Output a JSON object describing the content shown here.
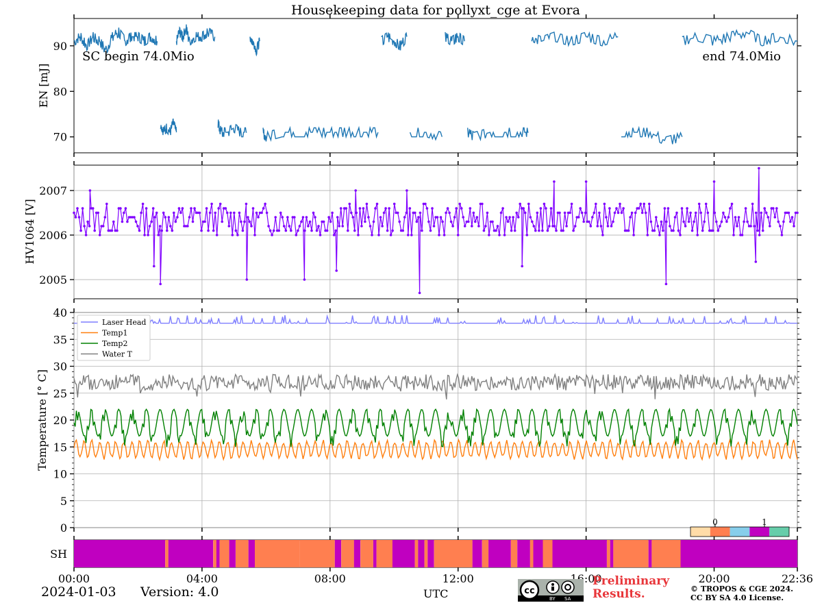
{
  "chart_data": [
    {
      "panel": "energy",
      "type": "line",
      "title": "Housekeeping data for pollyxt_cge at Evora",
      "ylabel": "EN [mJ]",
      "ylim": [
        66.5,
        96.0
      ],
      "yticks": [
        70,
        80,
        90
      ],
      "xlim": [
        0,
        22.6
      ],
      "annotations": {
        "left": "SC begin 74.0Mio",
        "right": "end 74.0Mio"
      },
      "color": "#1f77b4",
      "segments": [
        {
          "x": [
            0.0,
            0.2,
            0.4,
            0.6,
            0.8,
            1.0,
            1.2,
            1.4,
            1.6,
            1.8,
            2.0,
            2.2,
            2.4,
            2.6
          ],
          "y": [
            91,
            92,
            90,
            92,
            91,
            89,
            92,
            93,
            91,
            92,
            92,
            91,
            92,
            91
          ]
        },
        {
          "x": [
            2.7,
            2.8,
            2.9,
            3.0,
            3.1,
            3.2
          ],
          "y": [
            73,
            71,
            72,
            71,
            73,
            71
          ]
        },
        {
          "x": [
            3.2,
            3.3,
            3.4,
            3.5,
            3.6,
            3.8,
            4.0,
            4.2,
            4.4
          ],
          "y": [
            91,
            93,
            92,
            94,
            91,
            92,
            92,
            93,
            92
          ]
        },
        {
          "x": [
            4.5,
            4.6,
            4.8,
            5.0,
            5.2,
            5.4
          ],
          "y": [
            73,
            71,
            71,
            72,
            71,
            71
          ]
        },
        {
          "x": [
            5.5,
            5.6,
            5.7,
            5.8
          ],
          "y": [
            92,
            91,
            89,
            91
          ]
        },
        {
          "x": [
            5.9,
            6.0,
            6.5,
            7.0,
            7.5,
            8.0,
            8.5,
            9.0,
            9.5
          ],
          "y": [
            71,
            70,
            71,
            71,
            71,
            71,
            71,
            71,
            71
          ]
        },
        {
          "x": [
            9.6,
            9.8,
            10.0,
            10.2,
            10.4
          ],
          "y": [
            91,
            92,
            91,
            90,
            92
          ]
        },
        {
          "x": [
            10.5,
            11.0,
            11.5
          ],
          "y": [
            71,
            71,
            70
          ]
        },
        {
          "x": [
            11.6,
            11.8,
            12.0,
            12.2
          ],
          "y": [
            92,
            91,
            92,
            91
          ]
        },
        {
          "x": [
            12.3,
            12.5,
            13.0,
            13.5,
            14.0,
            14.2
          ],
          "y": [
            71,
            70,
            71,
            71,
            71,
            71
          ]
        },
        {
          "x": [
            14.3,
            14.6,
            15.0,
            15.5,
            16.0,
            16.5,
            17.0
          ],
          "y": [
            92,
            91,
            92,
            91,
            92,
            91,
            92
          ]
        },
        {
          "x": [
            17.1,
            17.5,
            18.0,
            18.5,
            19.0
          ],
          "y": [
            71,
            71,
            71,
            69,
            70
          ]
        },
        {
          "x": [
            19.0,
            19.5,
            20.0,
            20.5,
            21.0,
            21.5,
            22.0,
            22.6
          ],
          "y": [
            91,
            92,
            91,
            92,
            93,
            91,
            92,
            91
          ]
        }
      ]
    },
    {
      "panel": "hv1064",
      "type": "line",
      "ylabel": "HV1064 [V]",
      "ylim": [
        2004.57,
        2007.57
      ],
      "yticks": [
        2005,
        2006,
        2007
      ],
      "xlim": [
        0,
        22.6
      ],
      "color": "#8000ff",
      "base": 2006.3,
      "noise_range": [
        2006.0,
        2006.7
      ],
      "outliers": [
        {
          "x": 2.7,
          "y": 2004.9
        },
        {
          "x": 2.5,
          "y": 2005.3
        },
        {
          "x": 5.4,
          "y": 2005.0
        },
        {
          "x": 7.2,
          "y": 2005.0
        },
        {
          "x": 8.2,
          "y": 2005.2
        },
        {
          "x": 10.8,
          "y": 2004.7
        },
        {
          "x": 14.0,
          "y": 2005.3
        },
        {
          "x": 18.5,
          "y": 2004.9
        },
        {
          "x": 21.3,
          "y": 2005.4
        },
        {
          "x": 21.4,
          "y": 2007.5
        },
        {
          "x": 15.0,
          "y": 2007.2
        },
        {
          "x": 16.0,
          "y": 2007.2
        },
        {
          "x": 20.0,
          "y": 2007.2
        },
        {
          "x": 0.5,
          "y": 2007.0
        },
        {
          "x": 8.8,
          "y": 2007.0
        },
        {
          "x": 10.4,
          "y": 2007.0
        }
      ]
    },
    {
      "panel": "temperature",
      "type": "line",
      "ylabel": "Temperature [$^\\circ C$]",
      "ylim": [
        0,
        40
      ],
      "yticks": [
        0,
        5,
        10,
        15,
        20,
        25,
        30,
        35,
        40
      ],
      "xlim": [
        0,
        22.6
      ],
      "legend": "top-left",
      "series": [
        {
          "name": "Laser Head",
          "color": "#7f7fff",
          "base": 38,
          "amp": 1.0
        },
        {
          "name": "Temp1",
          "color": "#ff7f0e",
          "base": 14.5,
          "amp": 1.5
        },
        {
          "name": "Temp2",
          "color": "#008000",
          "base": 19.5,
          "amp": 2.5
        },
        {
          "name": "Water T",
          "color": "#808080",
          "base": 27,
          "amp": 1.5
        }
      ]
    },
    {
      "panel": "shutter",
      "type": "heatmap",
      "ylabel": "SH",
      "colorbar_ticks": [
        "0",
        "1"
      ],
      "colorbar_colors": [
        "#ffdca8",
        "#ff7f50",
        "#87ceeb",
        "#c000c0",
        "#66cdaa"
      ],
      "states": {
        "0": "#ff7f50",
        "1": "#c000c0"
      },
      "timeline": [
        {
          "start": 0.0,
          "end": 2.85,
          "state": "1"
        },
        {
          "start": 2.85,
          "end": 2.95,
          "state": "0"
        },
        {
          "start": 2.95,
          "end": 4.35,
          "state": "1"
        },
        {
          "start": 4.35,
          "end": 4.45,
          "state": "0"
        },
        {
          "start": 4.45,
          "end": 4.55,
          "state": "1"
        },
        {
          "start": 4.55,
          "end": 4.85,
          "state": "0"
        },
        {
          "start": 4.85,
          "end": 5.05,
          "state": "1"
        },
        {
          "start": 5.05,
          "end": 5.45,
          "state": "0"
        },
        {
          "start": 5.45,
          "end": 5.65,
          "state": "1"
        },
        {
          "start": 5.65,
          "end": 7.05,
          "state": "0"
        },
        {
          "start": 7.05,
          "end": 8.15,
          "state": "0"
        },
        {
          "start": 8.15,
          "end": 8.35,
          "state": "1"
        },
        {
          "start": 8.35,
          "end": 8.75,
          "state": "0"
        },
        {
          "start": 8.75,
          "end": 8.95,
          "state": "1"
        },
        {
          "start": 8.95,
          "end": 9.35,
          "state": "0"
        },
        {
          "start": 9.35,
          "end": 9.45,
          "state": "1"
        },
        {
          "start": 9.45,
          "end": 9.95,
          "state": "0"
        },
        {
          "start": 9.95,
          "end": 10.65,
          "state": "1"
        },
        {
          "start": 10.65,
          "end": 10.75,
          "state": "0"
        },
        {
          "start": 10.75,
          "end": 10.95,
          "state": "1"
        },
        {
          "start": 10.95,
          "end": 11.05,
          "state": "0"
        },
        {
          "start": 11.05,
          "end": 11.25,
          "state": "1"
        },
        {
          "start": 11.25,
          "end": 12.45,
          "state": "0"
        },
        {
          "start": 12.45,
          "end": 12.75,
          "state": "1"
        },
        {
          "start": 12.75,
          "end": 12.95,
          "state": "0"
        },
        {
          "start": 12.95,
          "end": 13.65,
          "state": "1"
        },
        {
          "start": 13.65,
          "end": 13.85,
          "state": "0"
        },
        {
          "start": 13.85,
          "end": 14.25,
          "state": "1"
        },
        {
          "start": 14.25,
          "end": 14.35,
          "state": "0"
        },
        {
          "start": 14.35,
          "end": 14.65,
          "state": "1"
        },
        {
          "start": 14.65,
          "end": 14.95,
          "state": "0"
        },
        {
          "start": 14.95,
          "end": 16.65,
          "state": "1"
        },
        {
          "start": 16.65,
          "end": 16.75,
          "state": "0"
        },
        {
          "start": 16.75,
          "end": 16.85,
          "state": "1"
        },
        {
          "start": 16.85,
          "end": 17.95,
          "state": "0"
        },
        {
          "start": 17.95,
          "end": 18.05,
          "state": "1"
        },
        {
          "start": 18.05,
          "end": 18.95,
          "state": "0"
        },
        {
          "start": 18.95,
          "end": 22.6,
          "state": "1"
        }
      ]
    }
  ],
  "x_axis": {
    "label": "UTC",
    "ticks": [
      {
        "x": 0,
        "label": "00:00"
      },
      {
        "x": 4,
        "label": "04:00"
      },
      {
        "x": 8,
        "label": "08:00"
      },
      {
        "x": 12,
        "label": "12:00"
      },
      {
        "x": 16,
        "label": "16:00"
      },
      {
        "x": 20,
        "label": "20:00"
      },
      {
        "x": 22.6,
        "label": "22:36"
      }
    ]
  },
  "footer": {
    "date": "2024-01-03",
    "version": "Version: 4.0",
    "preliminary": "Preliminary\nResults.",
    "copyright": "© TROPOS & CGE 2024.\nCC BY SA 4.0 License."
  }
}
